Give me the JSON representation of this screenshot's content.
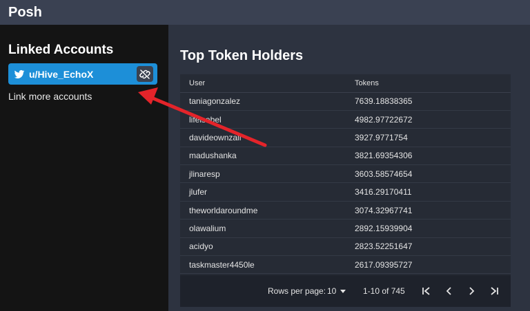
{
  "app": {
    "title": "Posh"
  },
  "sidebar": {
    "title": "Linked Accounts",
    "account": {
      "name": "u/Hive_EchoX",
      "icon": "twitter-bird-icon",
      "action_icon": "unlink-icon"
    },
    "link_more": "Link more accounts"
  },
  "main": {
    "title": "Top Token Holders",
    "table": {
      "headers": [
        "User",
        "Tokens"
      ],
      "rows": [
        [
          "taniagonzalez",
          "7639.18838365"
        ],
        [
          "lifeisabel",
          "4982.97722672"
        ],
        [
          "davideownzall",
          "3927.9771754"
        ],
        [
          "madushanka",
          "3821.69354306"
        ],
        [
          "jlinaresp",
          "3603.58574654"
        ],
        [
          "jlufer",
          "3416.29170411"
        ],
        [
          "theworldaroundme",
          "3074.32967741"
        ],
        [
          "olawalium",
          "2892.15939904"
        ],
        [
          "acidyo",
          "2823.52251647"
        ],
        [
          "taskmaster4450le",
          "2617.09395727"
        ]
      ]
    },
    "pagination": {
      "rows_per_page_label": "Rows per page:",
      "rows_per_page_value": "10",
      "range": "1-10 of 745"
    }
  },
  "colors": {
    "accent": "#1d8fd8",
    "arrow": "#e4242a",
    "sidebar_bg": "#141414",
    "main_bg": "#2d3340"
  }
}
